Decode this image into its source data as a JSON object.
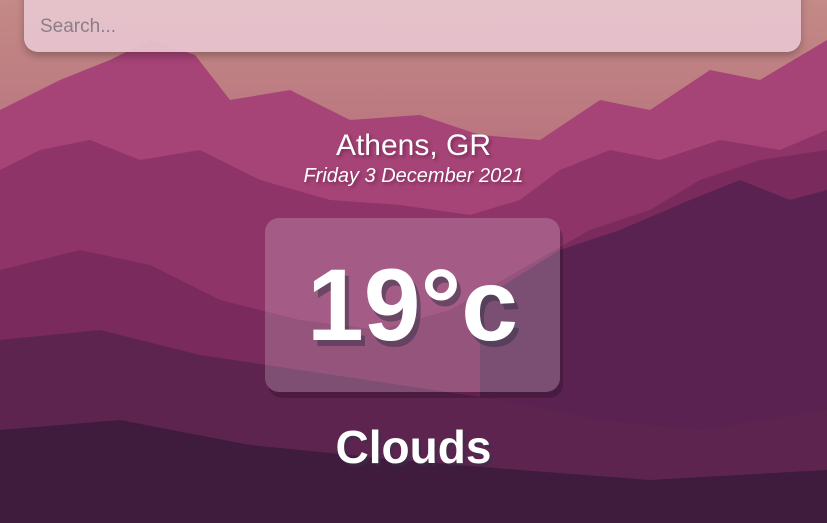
{
  "search": {
    "placeholder": "Search...",
    "value": ""
  },
  "location": {
    "city": "Athens, GR",
    "date": "Friday 3 December 2021"
  },
  "weather": {
    "temperature": "19°c",
    "condition": "Clouds"
  },
  "colors": {
    "sky_top": "#c07f86",
    "mountain_mid": "#9c3a74",
    "mountain_dark": "#4a1f47",
    "search_bg": "#e8c6d0"
  }
}
